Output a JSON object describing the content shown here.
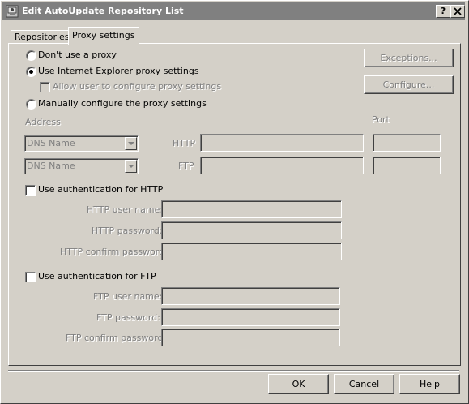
{
  "window": {
    "title": "Edit AutoUpdate Repository List",
    "help_label": "?",
    "close_label": "X"
  },
  "tabs": [
    {
      "label": "Repositories",
      "active": false
    },
    {
      "label": "Proxy settings",
      "active": true
    }
  ],
  "proxy": {
    "no_proxy_label": "Don't use a proxy",
    "ie_label": "Use Internet Explorer proxy settings",
    "allow_user_label": "Allow user to configure proxy settings",
    "manual_label": "Manually configure the proxy settings",
    "selected": "ie",
    "exceptions_label": "Exceptions...",
    "configure_label": "Configure..."
  },
  "address": {
    "header": "Address",
    "port_header": "Port",
    "http_label": "HTTP",
    "ftp_label": "FTP",
    "http_combo": "DNS Name",
    "ftp_combo": "DNS Name",
    "http_address": "",
    "ftp_address": "",
    "http_port": "",
    "ftp_port": ""
  },
  "http_auth": {
    "checkbox_label": "Use authentication for HTTP",
    "checked": false,
    "user_label": "HTTP user name:",
    "password_label": "HTTP password:",
    "confirm_label": "HTTP confirm password:"
  },
  "ftp_auth": {
    "checkbox_label": "Use authentication for FTP",
    "checked": false,
    "user_label": "FTP user name:",
    "password_label": "FTP password:",
    "confirm_label": "FTP confirm password:"
  },
  "buttons": {
    "ok": "OK",
    "cancel": "Cancel",
    "help": "Help"
  }
}
